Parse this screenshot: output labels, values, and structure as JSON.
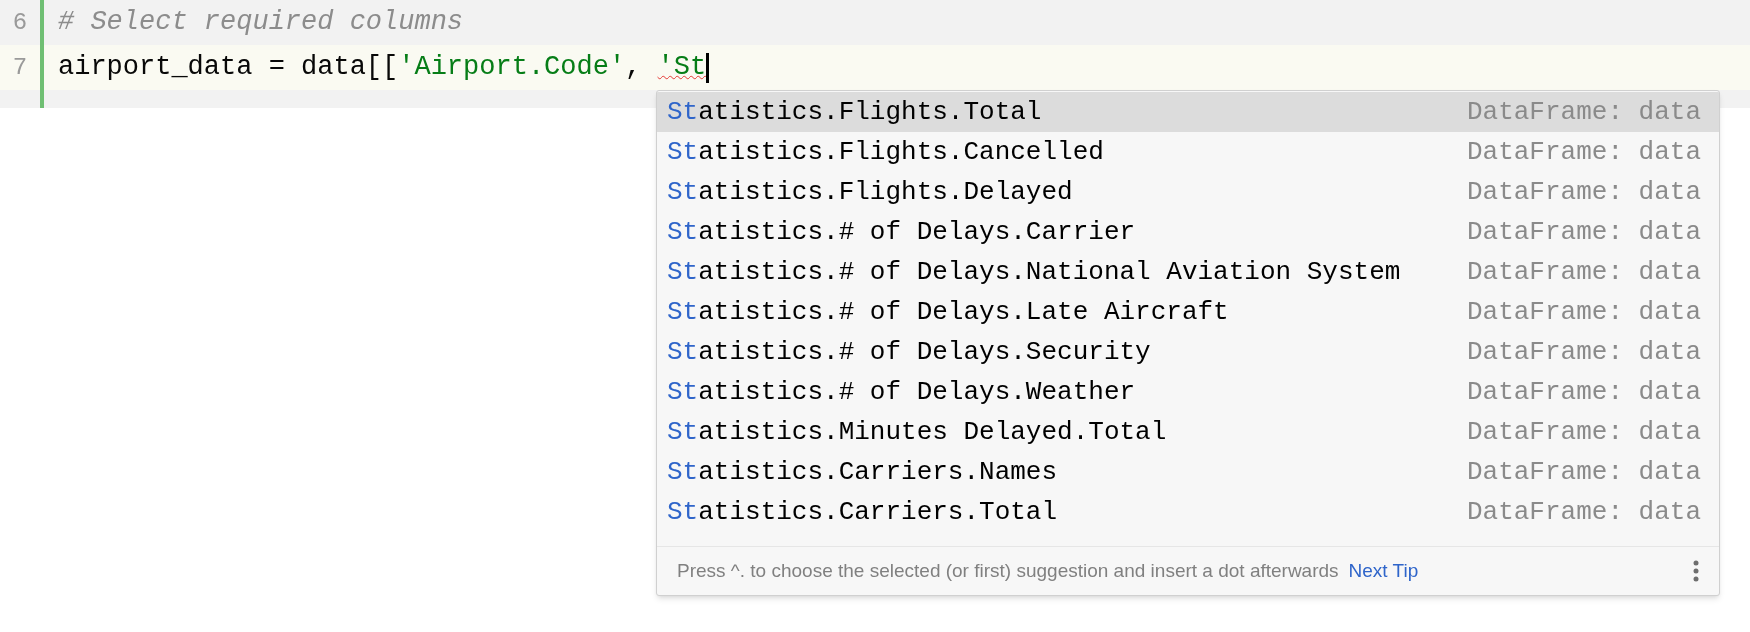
{
  "editor": {
    "lines": [
      {
        "number": "6",
        "current": false,
        "tokens": [
          {
            "kind": "comment",
            "text": "# Select required columns"
          }
        ]
      },
      {
        "number": "7",
        "current": true,
        "tokens": [
          {
            "kind": "plain",
            "text": "airport_data = data[["
          },
          {
            "kind": "string",
            "text": "'Airport.Code'"
          },
          {
            "kind": "plain",
            "text": ", "
          },
          {
            "kind": "error_string",
            "text": "'St"
          }
        ]
      }
    ]
  },
  "completion_popup": {
    "items": [
      {
        "match": "St",
        "rest": "atistics.Flights.Total",
        "type": "DataFrame: data",
        "selected": true
      },
      {
        "match": "St",
        "rest": "atistics.Flights.Cancelled",
        "type": "DataFrame: data",
        "selected": false
      },
      {
        "match": "St",
        "rest": "atistics.Flights.Delayed",
        "type": "DataFrame: data",
        "selected": false
      },
      {
        "match": "St",
        "rest": "atistics.# of Delays.Carrier",
        "type": "DataFrame: data",
        "selected": false
      },
      {
        "match": "St",
        "rest": "atistics.# of Delays.National Aviation System",
        "type": "DataFrame: data",
        "selected": false
      },
      {
        "match": "St",
        "rest": "atistics.# of Delays.Late Aircraft",
        "type": "DataFrame: data",
        "selected": false
      },
      {
        "match": "St",
        "rest": "atistics.# of Delays.Security",
        "type": "DataFrame: data",
        "selected": false
      },
      {
        "match": "St",
        "rest": "atistics.# of Delays.Weather",
        "type": "DataFrame: data",
        "selected": false
      },
      {
        "match": "St",
        "rest": "atistics.Minutes Delayed.Total",
        "type": "DataFrame: data",
        "selected": false
      },
      {
        "match": "St",
        "rest": "atistics.Carriers.Names",
        "type": "DataFrame: data",
        "selected": false
      },
      {
        "match": "St",
        "rest": "atistics.Carriers.Total",
        "type": "DataFrame: data",
        "selected": false
      }
    ],
    "footer": {
      "hint": "Press ^. to choose the selected (or first) suggestion and insert a dot afterwards",
      "link": "Next Tip"
    }
  }
}
